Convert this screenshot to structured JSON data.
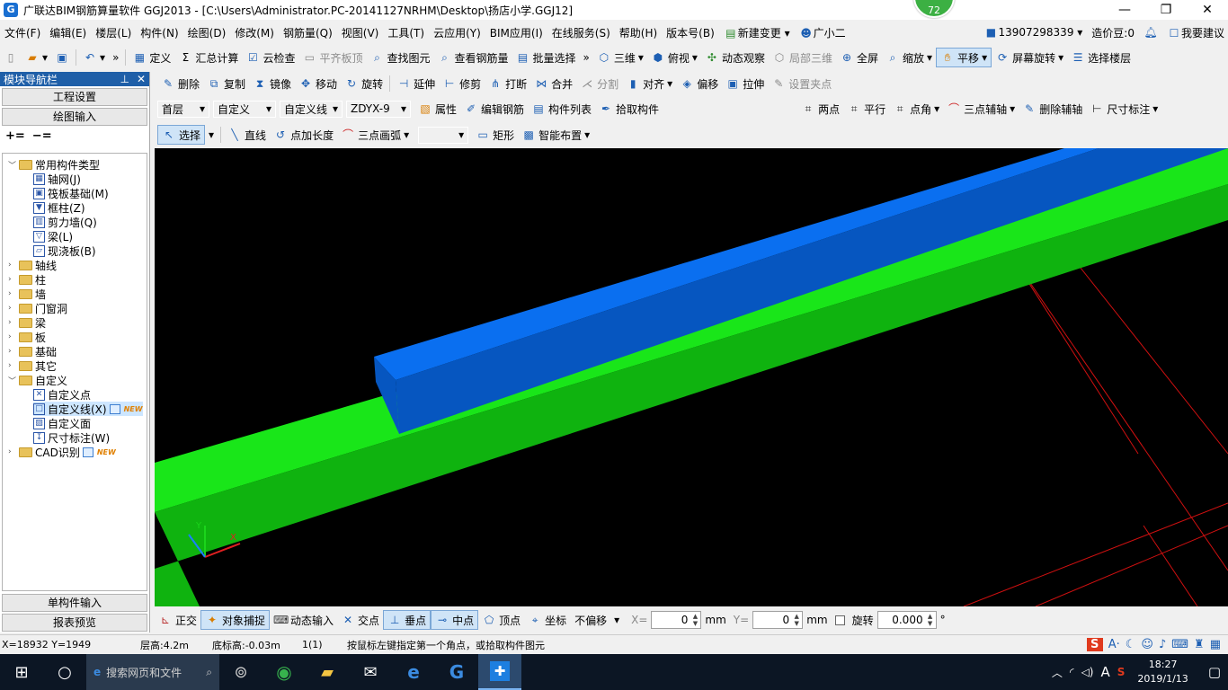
{
  "window": {
    "title": "广联达BIM钢筋算量软件 GGJ2013 - [C:\\Users\\Administrator.PC-20141127NRHM\\Desktop\\扬店小学.GGJ12]",
    "badge": "72"
  },
  "menu": [
    "文件(F)",
    "编辑(E)",
    "楼层(L)",
    "构件(N)",
    "绘图(D)",
    "修改(M)",
    "钢筋量(Q)",
    "视图(V)",
    "工具(T)",
    "云应用(Y)",
    "BIM应用(I)",
    "在线服务(S)",
    "帮助(H)",
    "版本号(B)",
    "新建变更",
    "广小二"
  ],
  "user": {
    "phone": "13907298339",
    "zaojiadou": "造价豆:0",
    "suggest": "我要建议"
  },
  "toolbar1": {
    "define": "定义",
    "sum": "汇总计算",
    "cloudcheck": "云检查",
    "flush_top": "平齐板顶",
    "find": "查找图元",
    "view_rebar": "查看钢筋量",
    "batch_select": "批量选择",
    "view3d": "三维",
    "topview": "俯视",
    "dynamic": "动态观察",
    "local3d": "局部三维",
    "fullscreen": "全屏",
    "zoom": "缩放",
    "pan": "平移",
    "screen_rotate": "屏幕旋转",
    "select_floor": "选择楼层"
  },
  "toolbar2": {
    "delete": "删除",
    "copy": "复制",
    "mirror": "镜像",
    "move": "移动",
    "rotate": "旋转",
    "extend": "延伸",
    "trim": "修剪",
    "break": "打断",
    "merge": "合并",
    "split": "分割",
    "align": "对齐",
    "offset": "偏移",
    "stretch": "拉伸",
    "set_grip": "设置夹点"
  },
  "toolbar3": {
    "floor": "首层",
    "type": "自定义",
    "subtype": "自定义线",
    "component": "ZDYX-9",
    "property": "属性",
    "edit_rebar": "编辑钢筋",
    "comp_list": "构件列表",
    "pick": "拾取构件",
    "two_point": "两点",
    "parallel": "平行",
    "point_angle": "点角",
    "three_point_axis": "三点辅轴",
    "delete_aux": "删除辅轴",
    "dimension": "尺寸标注"
  },
  "toolbar4": {
    "select": "选择",
    "line": "直线",
    "point_length": "点加长度",
    "arc": "三点画弧",
    "rect": "矩形",
    "smart": "智能布置"
  },
  "panel": {
    "title": "模块导航栏",
    "project_settings": "工程设置",
    "drawing_input": "绘图输入",
    "single_input": "单构件输入",
    "report": "报表预览",
    "tree": [
      {
        "label": "常用构件类型",
        "level": 0,
        "expand": "﹀",
        "kind": "folder"
      },
      {
        "label": "轴网(J)",
        "level": 1,
        "kind": "grid"
      },
      {
        "label": "筏板基础(M)",
        "level": 1,
        "kind": "raft"
      },
      {
        "label": "框柱(Z)",
        "level": 1,
        "kind": "column"
      },
      {
        "label": "剪力墙(Q)",
        "level": 1,
        "kind": "wall"
      },
      {
        "label": "梁(L)",
        "level": 1,
        "kind": "beam"
      },
      {
        "label": "现浇板(B)",
        "level": 1,
        "kind": "slab"
      },
      {
        "label": "轴线",
        "level": 0,
        "expand": "›",
        "kind": "folder"
      },
      {
        "label": "柱",
        "level": 0,
        "expand": "›",
        "kind": "folder"
      },
      {
        "label": "墙",
        "level": 0,
        "expand": "›",
        "kind": "folder"
      },
      {
        "label": "门窗洞",
        "level": 0,
        "expand": "›",
        "kind": "folder"
      },
      {
        "label": "梁",
        "level": 0,
        "expand": "›",
        "kind": "folder"
      },
      {
        "label": "板",
        "level": 0,
        "expand": "›",
        "kind": "folder"
      },
      {
        "label": "基础",
        "level": 0,
        "expand": "›",
        "kind": "folder"
      },
      {
        "label": "其它",
        "level": 0,
        "expand": "›",
        "kind": "folder"
      },
      {
        "label": "自定义",
        "level": 0,
        "expand": "﹀",
        "kind": "folder"
      },
      {
        "label": "自定义点",
        "level": 1,
        "kind": "cpoint"
      },
      {
        "label": "自定义线(X)",
        "level": 1,
        "kind": "cline",
        "new": "NEW",
        "selected": true
      },
      {
        "label": "自定义面",
        "level": 1,
        "kind": "cface"
      },
      {
        "label": "尺寸标注(W)",
        "level": 1,
        "kind": "dim"
      },
      {
        "label": "CAD识别",
        "level": 0,
        "expand": "›",
        "kind": "folder",
        "new": "NEW"
      }
    ]
  },
  "snapbar": {
    "ortho": "正交",
    "obj_snap": "对象捕捉",
    "dyn_input": "动态输入",
    "intersect": "交点",
    "perp": "垂点",
    "mid": "中点",
    "vertex": "顶点",
    "coord": "坐标",
    "offset_mode": "不偏移",
    "x_label": "X=",
    "x_val": "0",
    "y_label": "Y=",
    "y_val": "0",
    "unit": "mm",
    "rotate": "旋转",
    "rotate_val": "0.000",
    "deg": "°"
  },
  "status": {
    "coords": "X=18932 Y=1949",
    "floor_h": "层高:4.2m",
    "base_h": "底标高:-0.03m",
    "count": "1(1)",
    "hint": "按鼠标左键指定第一个角点，或拾取构件图元"
  },
  "taskbar": {
    "search": "搜索网页和文件",
    "time": "18:27",
    "date": "2019/1/13"
  },
  "colors": {
    "green": "#19e619",
    "green_dark": "#0fb30f",
    "blue": "#0a6ff0",
    "blue_dark": "#0656c0",
    "grid_red": "#d01010"
  }
}
